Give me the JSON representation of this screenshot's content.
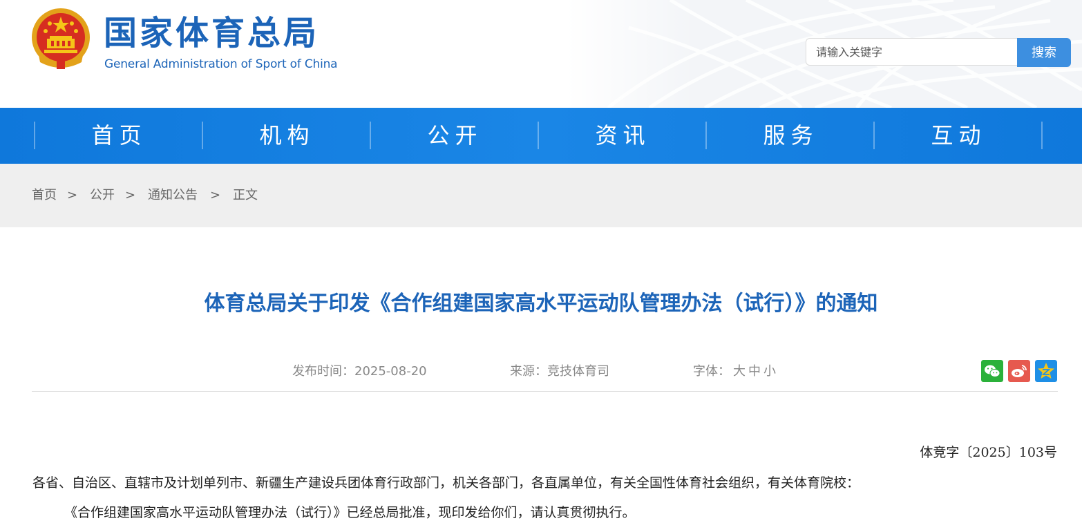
{
  "header": {
    "title_cn": "国家体育总局",
    "title_en": "General Administration of Sport of China",
    "search": {
      "placeholder": "请输入关键字",
      "button_label": "搜索"
    }
  },
  "nav": {
    "items": [
      "首页",
      "机构",
      "公开",
      "资讯",
      "服务",
      "互动"
    ]
  },
  "breadcrumb": {
    "items": [
      "首页",
      "公开",
      "通知公告",
      "正文"
    ],
    "separator": ">"
  },
  "article": {
    "title": "体育总局关于印发《合作组建国家高水平运动队管理办法（试行）》的通知",
    "publish_time_label": "发布时间：",
    "publish_time": "2025-08-20",
    "source_label": "来源：",
    "source": "竞技体育司",
    "font_label": "字体：",
    "font_sizes": [
      "大",
      "中",
      "小"
    ],
    "doc_number": "体竞字〔2025〕103号",
    "paragraphs": [
      "各省、自治区、直辖市及计划单列市、新疆生产建设兵团体育行政部门，机关各部门，各直属单位，有关全国性体育社会组织，有关体育院校：",
      "《合作组建国家高水平运动队管理办法（试行）》已经总局批准，现印发给你们，请认真贯彻执行。"
    ]
  },
  "share": {
    "icons": [
      "wechat-icon",
      "weibo-icon",
      "qzone-icon"
    ]
  },
  "colors": {
    "brand_blue": "#1c64b8",
    "nav_blue": "#0f78db",
    "search_button": "#3d8fe0",
    "wechat": "#2bb13a",
    "weibo": "#e6594f",
    "qzone": "#1e8fe6"
  }
}
